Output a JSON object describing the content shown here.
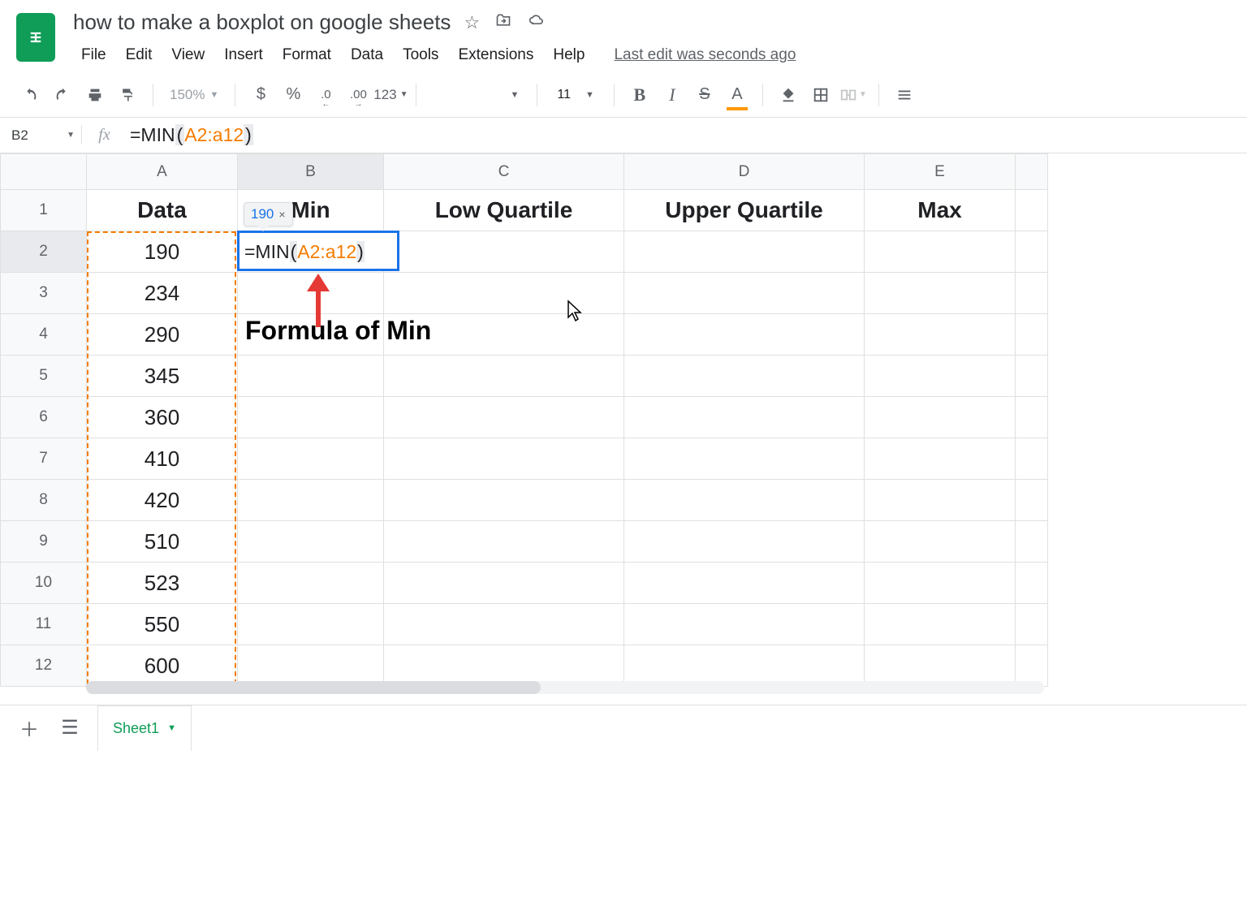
{
  "doc": {
    "title": "how to make a boxplot on google sheets",
    "last_edit": "Last edit was seconds ago"
  },
  "menu": {
    "file": "File",
    "edit": "Edit",
    "view": "View",
    "insert": "Insert",
    "format": "Format",
    "data": "Data",
    "tools": "Tools",
    "extensions": "Extensions",
    "help": "Help"
  },
  "toolbar": {
    "zoom": "150%",
    "currency": "$",
    "percent": "%",
    "dec_dec": ".0",
    "inc_dec": ".00",
    "numfmt": "123",
    "font_size": "11",
    "bold": "B",
    "italic": "I",
    "strike": "S",
    "textcolor": "A"
  },
  "formula": {
    "cell_ref": "B2",
    "prefix": "=MIN",
    "open": "(",
    "range": "A2:a12",
    "close": ")"
  },
  "result_tip": {
    "value": "190",
    "close": "×"
  },
  "columns": [
    "A",
    "B",
    "C",
    "D",
    "E"
  ],
  "headers": {
    "A": "Data",
    "B": "Min",
    "C": "Low Quartile",
    "D": "Upper Quartile",
    "E": "Max"
  },
  "rows": {
    "2": "190",
    "3": "234",
    "4": "290",
    "5": "345",
    "6": "360",
    "7": "410",
    "8": "420",
    "9": "510",
    "10": "523",
    "11": "550",
    "12": "600"
  },
  "annotation": {
    "label": "Formula of Min"
  },
  "sheet": {
    "name": "Sheet1"
  }
}
